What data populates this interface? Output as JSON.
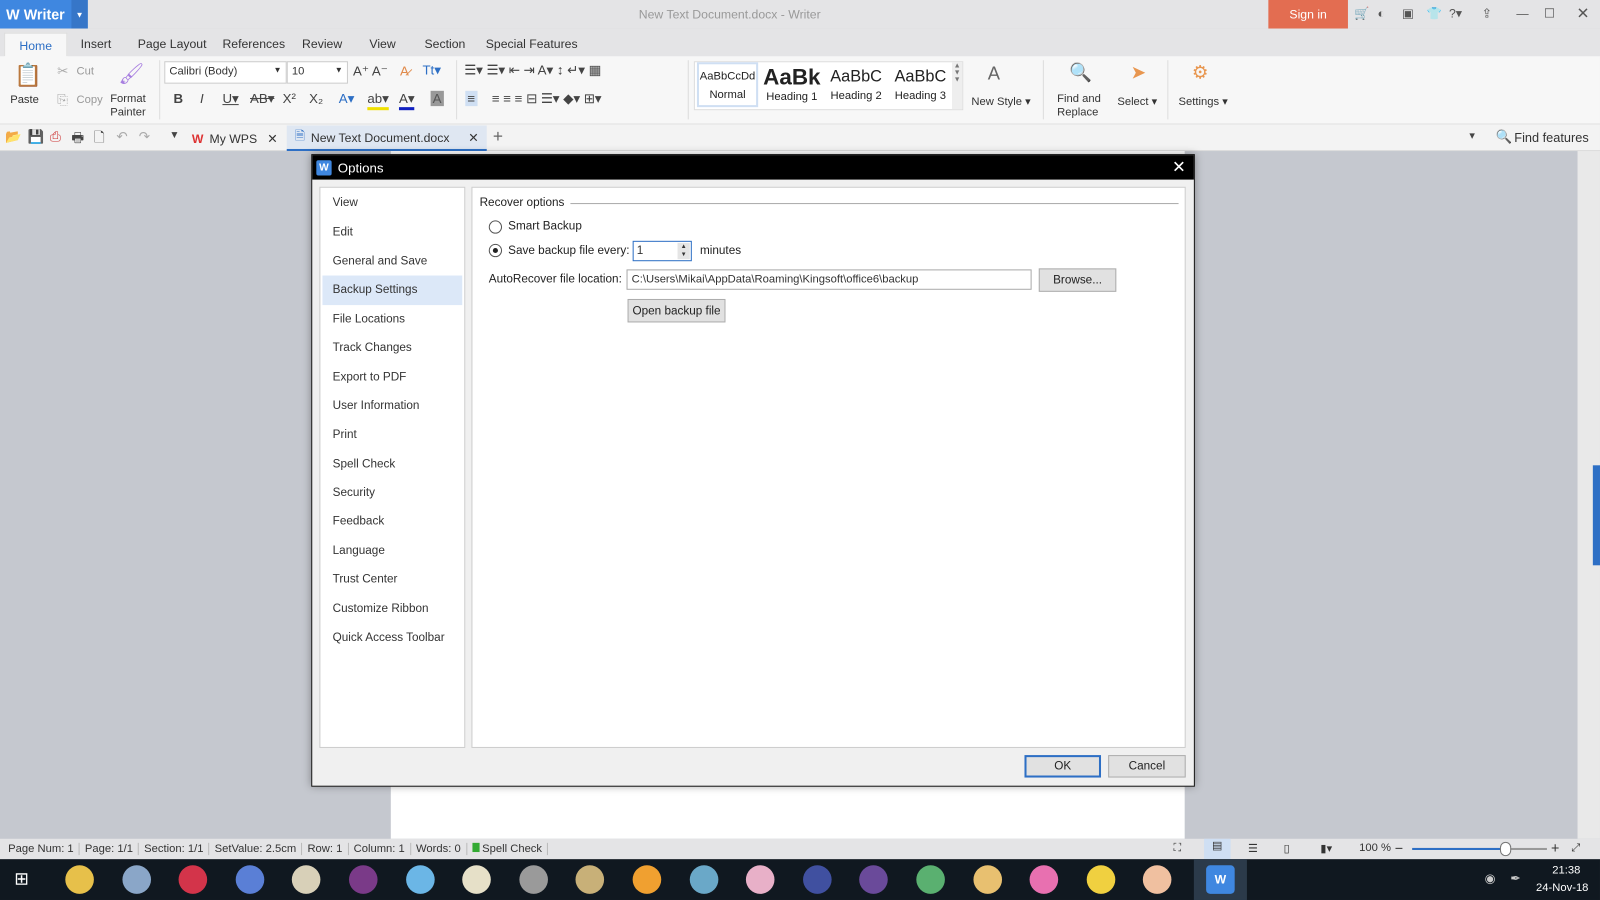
{
  "app": {
    "name": "Writer",
    "window_title": "New Text Document.docx - Writer",
    "sign_in": "Sign in"
  },
  "menu_tabs": [
    "Home",
    "Insert",
    "Page Layout",
    "References",
    "Review",
    "View",
    "Section",
    "Special Features"
  ],
  "ribbon": {
    "paste": "Paste",
    "cut": "Cut",
    "copy": "Copy",
    "format_painter_1": "Format",
    "format_painter_2": "Painter",
    "font_name": "Calibri (Body)",
    "font_size": "10",
    "styles": [
      {
        "preview": "AaBbCcDd",
        "label": "Normal"
      },
      {
        "preview": "AaBk",
        "label": "Heading 1"
      },
      {
        "preview": "AaBbC",
        "label": "Heading 2"
      },
      {
        "preview": "AaBbC",
        "label": "Heading 3"
      }
    ],
    "new_style": "New Style",
    "find_replace_1": "Find and",
    "find_replace_2": "Replace",
    "select": "Select",
    "settings": "Settings"
  },
  "doc_tabs": [
    {
      "label": "My WPS"
    },
    {
      "label": "New Text Document.docx"
    }
  ],
  "find_features": "Find features",
  "dialog": {
    "title": "Options",
    "nav": [
      "View",
      "Edit",
      "General and Save",
      "Backup Settings",
      "File Locations",
      "Track Changes",
      "Export to PDF",
      "User Information",
      "Print",
      "Spell Check",
      "Security",
      "Feedback",
      "Language",
      "Trust Center",
      "Customize Ribbon",
      "Quick Access Toolbar"
    ],
    "active_nav": "Backup Settings",
    "group_title": "Recover options",
    "smart_backup": "Smart Backup",
    "save_every": "Save backup file every:",
    "minutes_value": "1",
    "minutes": "minutes",
    "location_label": "AutoRecover file location:",
    "location_value": "C:\\Users\\Mikai\\AppData\\Roaming\\Kingsoft\\office6\\backup",
    "browse": "Browse...",
    "open_backup": "Open backup file",
    "ok": "OK",
    "cancel": "Cancel"
  },
  "status": {
    "page_num": "Page Num: 1",
    "page": "Page: 1/1",
    "section": "Section: 1/1",
    "setvalue": "SetValue: 2.5cm",
    "row": "Row: 1",
    "column": "Column: 1",
    "words": "Words: 0",
    "spell": "Spell Check",
    "zoom": "100 %",
    "zoom_fraction": 0.7
  },
  "taskbar": {
    "time": "21:38",
    "date": "24-Nov-18"
  },
  "colors": {
    "accent": "#3f87e0",
    "signin": "#e36d51"
  }
}
